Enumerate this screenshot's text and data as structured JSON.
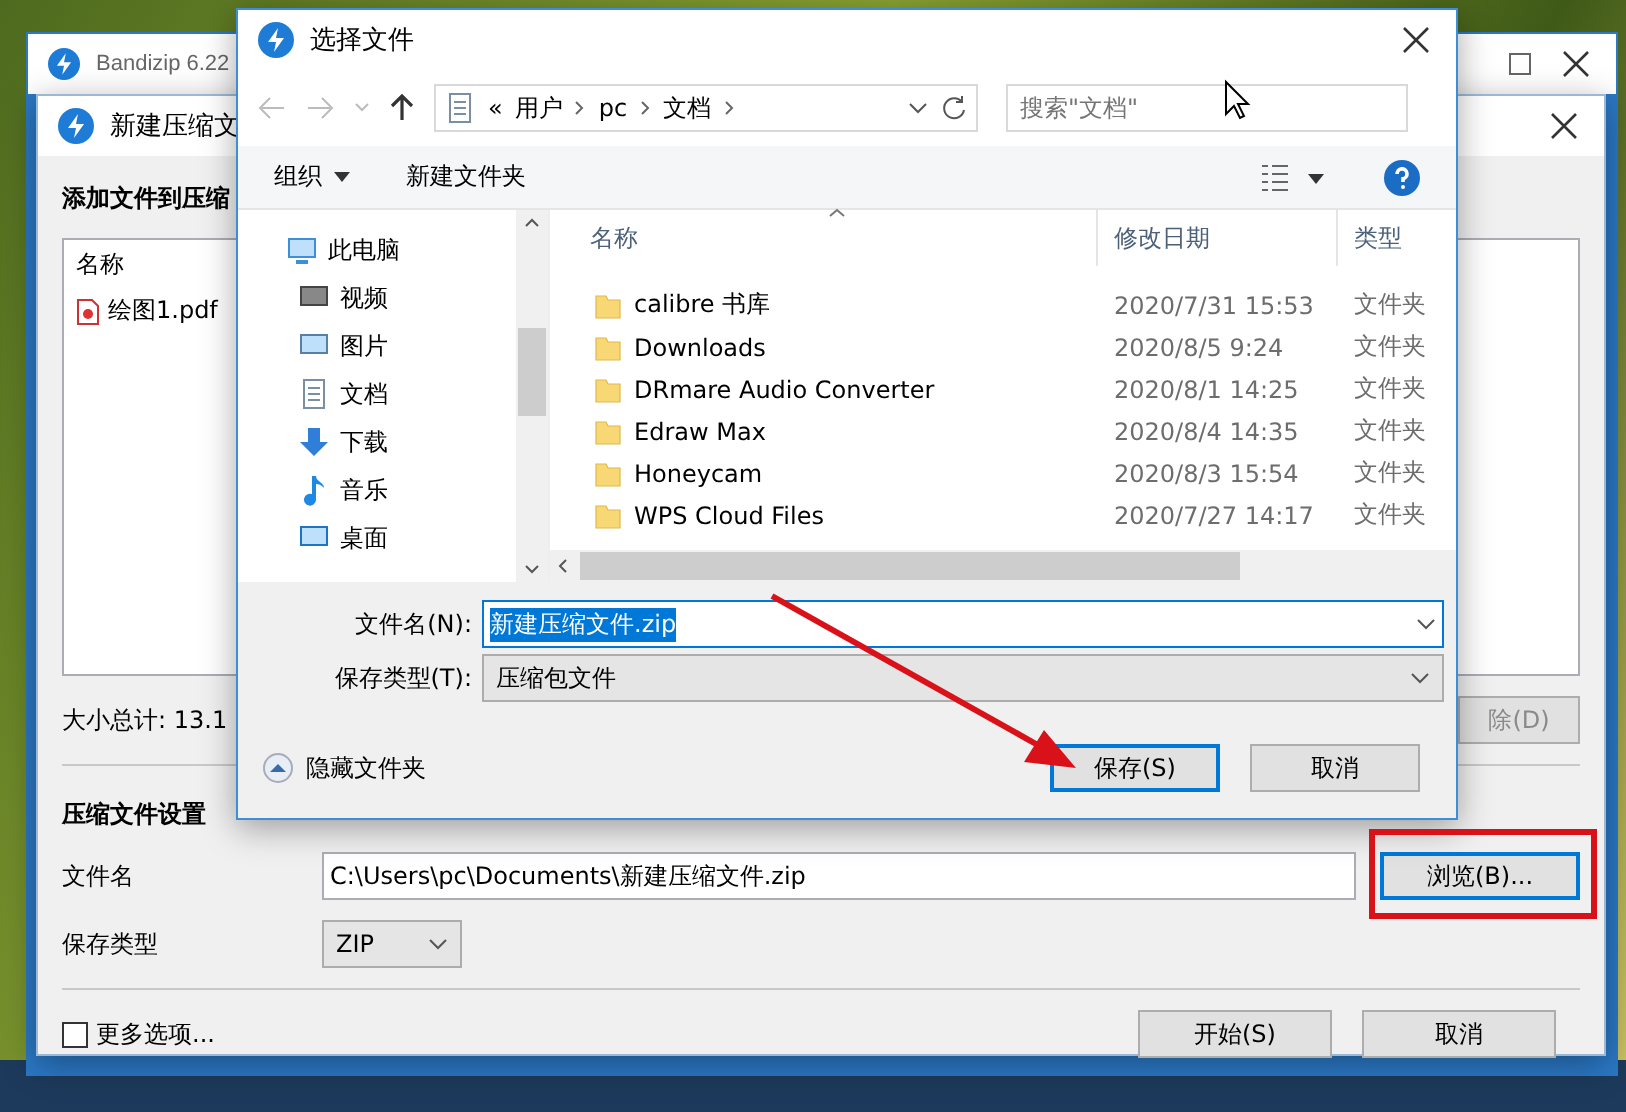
{
  "back_window": {
    "title": "Bandizip 6.22"
  },
  "compress_dialog": {
    "title": "新建压缩文",
    "heading": "添加文件到压缩",
    "file_list": {
      "column": "名称",
      "rows": [
        {
          "name": "绘图1.pdf"
        }
      ]
    },
    "size_total": "大小总计: 13.1",
    "delete_button": {
      "label": "除(D)",
      "disabled": true
    },
    "settings_heading": "压缩文件设置",
    "filename_label": "文件名",
    "filename_value": "C:\\Users\\pc\\Documents\\新建压缩文件.zip",
    "browse_button": {
      "label": "浏览(B)...",
      "highlighted": true
    },
    "type_label": "保存类型",
    "type_value": "ZIP",
    "more_options": {
      "label": "更多选项...",
      "checked": false
    },
    "buttons": [
      {
        "label": "开始(S)"
      },
      {
        "label": "取消"
      }
    ]
  },
  "save_dialog": {
    "title": "选择文件",
    "breadcrumb": [
      "«",
      "用户",
      "pc",
      "文档"
    ],
    "search": {
      "placeholder": "搜索\"文档\""
    },
    "toolbar": [
      {
        "label": "组织",
        "kind": "menu"
      },
      {
        "label": "新建文件夹",
        "kind": "button"
      }
    ],
    "nav": [
      {
        "label": "此电脑",
        "kind": "computer",
        "children": [
          {
            "label": "视频",
            "kind": "video"
          },
          {
            "label": "图片",
            "kind": "picture"
          },
          {
            "label": "文档",
            "kind": "document"
          },
          {
            "label": "下载",
            "kind": "download"
          },
          {
            "label": "音乐",
            "kind": "music"
          },
          {
            "label": "桌面",
            "kind": "desktop"
          }
        ]
      }
    ],
    "columns": [
      "名称",
      "修改日期",
      "类型"
    ],
    "files": [
      {
        "name": "calibre 书库",
        "modified": "2020/7/31 15:53",
        "type": "文件夹"
      },
      {
        "name": "Downloads",
        "modified": "2020/8/5 9:24",
        "type": "文件夹"
      },
      {
        "name": "DRmare Audio Converter",
        "modified": "2020/8/1 14:25",
        "type": "文件夹"
      },
      {
        "name": "Edraw Max",
        "modified": "2020/8/4 14:35",
        "type": "文件夹"
      },
      {
        "name": "Honeycam",
        "modified": "2020/8/3 15:54",
        "type": "文件夹"
      },
      {
        "name": "WPS Cloud Files",
        "modified": "2020/7/27 14:17",
        "type": "文件夹"
      }
    ],
    "filename_label": "文件名(N):",
    "filename_value": "新建压缩文件.zip",
    "filename_selected": true,
    "type_label": "保存类型(T):",
    "type_value": "压缩包文件",
    "hide_folders": "隐藏文件夹",
    "buttons": [
      {
        "label": "保存(S)",
        "default": true
      },
      {
        "label": "取消",
        "default": false
      }
    ]
  }
}
